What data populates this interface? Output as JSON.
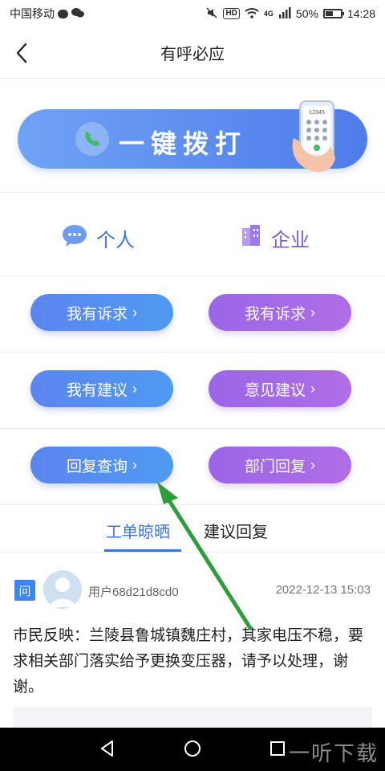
{
  "status": {
    "carrier": "中国移动",
    "network": "4G",
    "battery": "50%",
    "time": "14:28",
    "hd": "HD"
  },
  "header": {
    "title": "有呼必应"
  },
  "banner": {
    "label": "一键拨打",
    "phone_screen_number": "12345"
  },
  "categories": {
    "personal": "个人",
    "company": "企业"
  },
  "actions": {
    "row1": {
      "left": "我有诉求",
      "right": "我有诉求"
    },
    "row2": {
      "left": "我有建议",
      "right": "意见建议"
    },
    "row3": {
      "left": "回复查询",
      "right": "部门回复"
    }
  },
  "feed_tabs": {
    "active": "工单晾晒",
    "inactive": "建议回复"
  },
  "post": {
    "badge": "问",
    "user": "用户68d21d8cd0",
    "time": "2022-12-13 15:03",
    "body": "市民反映：兰陵县鲁城镇魏庄村，其家电压不稳，要求相关部门落实给予更换变压器，请予以处理，谢谢。"
  },
  "watermark": "一听下载",
  "colors": {
    "accent_blue": "#3d73e6",
    "accent_purple": "#7f57e3",
    "arrow_green": "#2e9e3a"
  }
}
